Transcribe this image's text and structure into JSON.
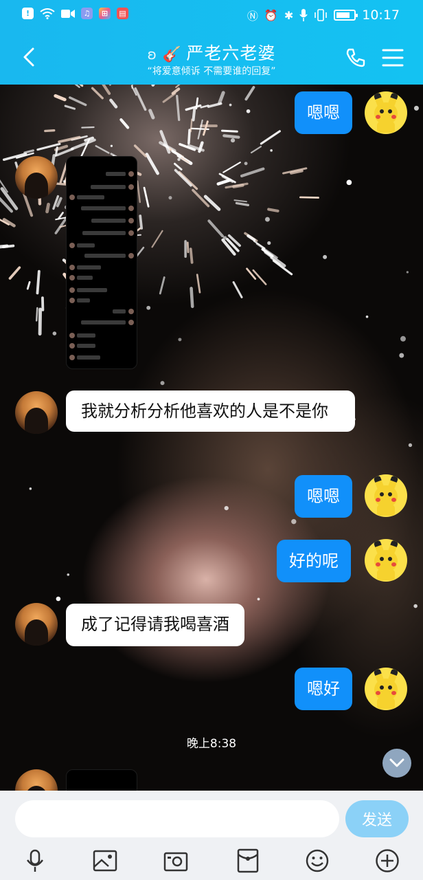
{
  "status_bar": {
    "time": "10:17",
    "left_icons": [
      "alert-icon",
      "wifi-icon",
      "video-icon",
      "music-app-icon",
      "colorful-app-icon",
      "red-app-icon"
    ],
    "right_icons": [
      "nfc-icon",
      "alarm-icon",
      "bluetooth-icon",
      "mic-icon",
      "vibrate-icon",
      "battery-icon"
    ],
    "battery_level": 0.8
  },
  "header": {
    "title": "严老六老婆",
    "subtitle": "“将爱意倾诉 不需要谁的回复”",
    "ear_glyph": "ʚ",
    "guitar_glyph": "🎸"
  },
  "messages": [
    {
      "side": "right",
      "type": "text",
      "text": "嗯嗯"
    },
    {
      "side": "left",
      "type": "image"
    },
    {
      "side": "left",
      "type": "text",
      "text": "我就分析分析他喜欢的人是不是你"
    },
    {
      "side": "right",
      "type": "text",
      "text": "嗯嗯"
    },
    {
      "side": "right",
      "type": "text",
      "text": "好的呢"
    },
    {
      "side": "left",
      "type": "text",
      "text": "成了记得请我喝喜酒"
    },
    {
      "side": "right",
      "type": "text",
      "text": "嗯好"
    },
    {
      "type": "timestamp",
      "text": "晚上8:38"
    },
    {
      "side": "left",
      "type": "image"
    }
  ],
  "input": {
    "placeholder": "",
    "value": "",
    "send_label": "发送"
  },
  "toolbar": [
    "mic-icon",
    "image-icon",
    "camera-icon",
    "red-packet-icon",
    "emoji-icon",
    "plus-icon"
  ],
  "colors": {
    "header": "#19b8ef",
    "bubble_right": "#1190fa",
    "send_button": "#8bd1f7",
    "input_bar": "#eff1f4"
  }
}
